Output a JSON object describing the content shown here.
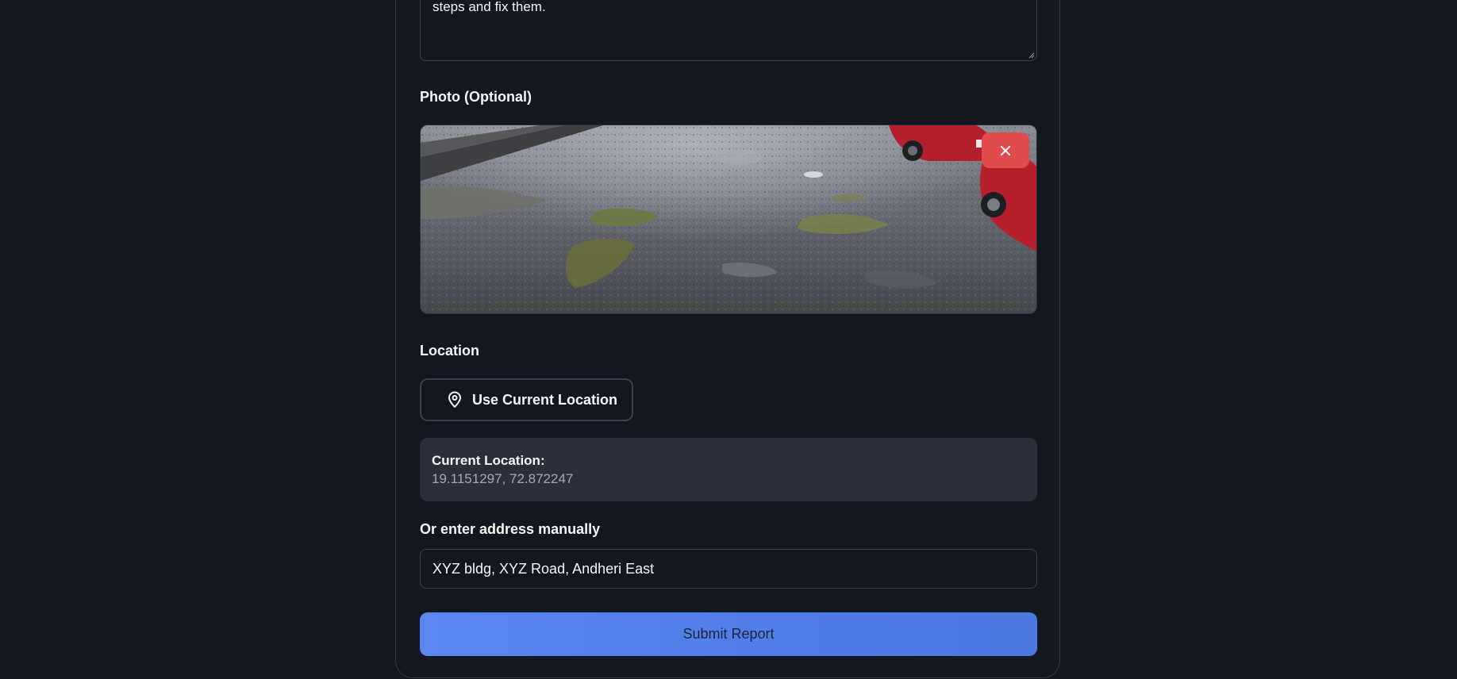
{
  "description_field": {
    "value_visible": "steps and fix them."
  },
  "photo_section": {
    "label": "Photo (Optional)",
    "image_alt": "Photo of a wet, potholed road with puddles and parked red cars",
    "remove_icon": "close-icon",
    "remove_color": "#e24b4b"
  },
  "location_section": {
    "label": "Location",
    "use_location_label": "Use Current Location",
    "use_location_icon": "map-pin-icon",
    "current_location_title": "Current Location:",
    "current_location_value": "19.1151297, 72.872247"
  },
  "manual_address": {
    "label": "Or enter address manually",
    "value": "XYZ bldg, XYZ Road, Andheri East"
  },
  "submit": {
    "label": "Submit Report",
    "color": "#5a87f2"
  }
}
